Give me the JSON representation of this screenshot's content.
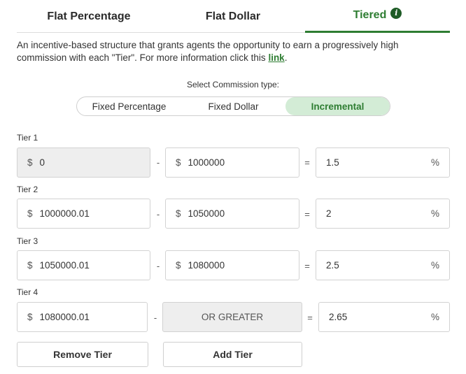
{
  "tabs": [
    {
      "label": "Flat Percentage"
    },
    {
      "label": "Flat Dollar"
    },
    {
      "label": "Tiered",
      "active": true
    }
  ],
  "description": {
    "text": "An incentive-based structure that grants agents the opportunity to earn a progressively high commission with each \"Tier\". For more information click this ",
    "link_text": "link",
    "suffix": "."
  },
  "commission_type": {
    "label": "Select Commission type:",
    "options": [
      "Fixed Percentage",
      "Fixed Dollar",
      "Incremental"
    ],
    "selected": "Incremental"
  },
  "currency_symbol": "$",
  "percent_symbol": "%",
  "dash": "-",
  "equals": "=",
  "tiers": [
    {
      "label": "Tier 1",
      "from": "0",
      "to": "1000000",
      "rate": "1.5"
    },
    {
      "label": "Tier 2",
      "from": "1000000.01",
      "to": "1050000",
      "rate": "2"
    },
    {
      "label": "Tier 3",
      "from": "1050000.01",
      "to": "1080000",
      "rate": "2.5"
    },
    {
      "label": "Tier 4",
      "from": "1080000.01",
      "to": "OR GREATER",
      "rate": "2.65"
    }
  ],
  "buttons": {
    "remove": "Remove Tier",
    "add": "Add Tier"
  },
  "colors": {
    "accent": "#2e7d32",
    "accent_light": "#d3ecd6",
    "disabled_bg": "#eeeeee",
    "border": "#d2d2d2"
  }
}
